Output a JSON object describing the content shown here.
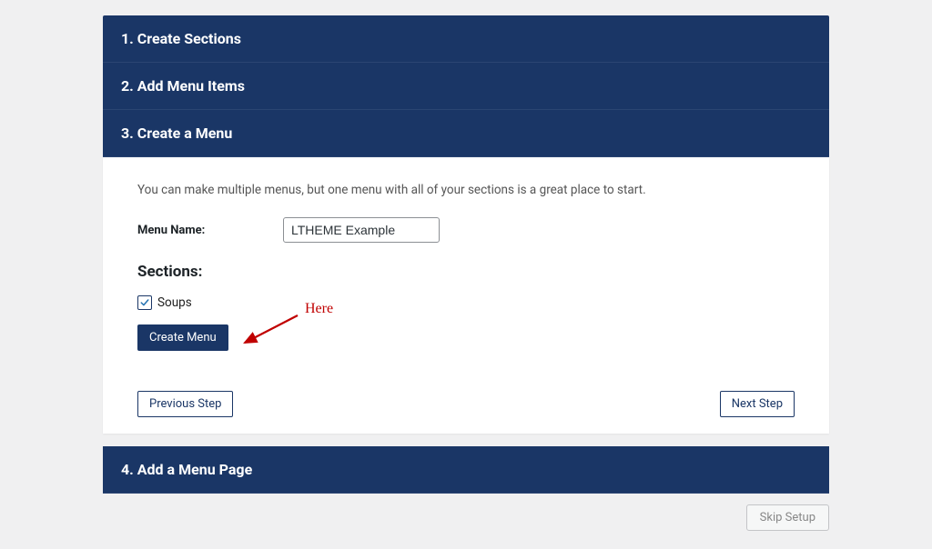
{
  "steps": {
    "s1": "1. Create Sections",
    "s2": "2. Add Menu Items",
    "s3": "3. Create a Menu",
    "s4": "4. Add a Menu Page"
  },
  "panel": {
    "intro": "You can make multiple menus, but one menu with all of your sections is a great place to start.",
    "menu_name_label": "Menu Name:",
    "menu_name_value": "LTHEME Example",
    "sections_label": "Sections:",
    "section_items": [
      {
        "label": "Soups",
        "checked": true
      }
    ],
    "create_menu_label": "Create Menu",
    "prev_label": "Previous Step",
    "next_label": "Next Step"
  },
  "annotation": {
    "text": "Here"
  },
  "footer": {
    "skip_label": "Skip Setup"
  },
  "colors": {
    "accent": "#1a3666",
    "annotation": "#c00000"
  }
}
